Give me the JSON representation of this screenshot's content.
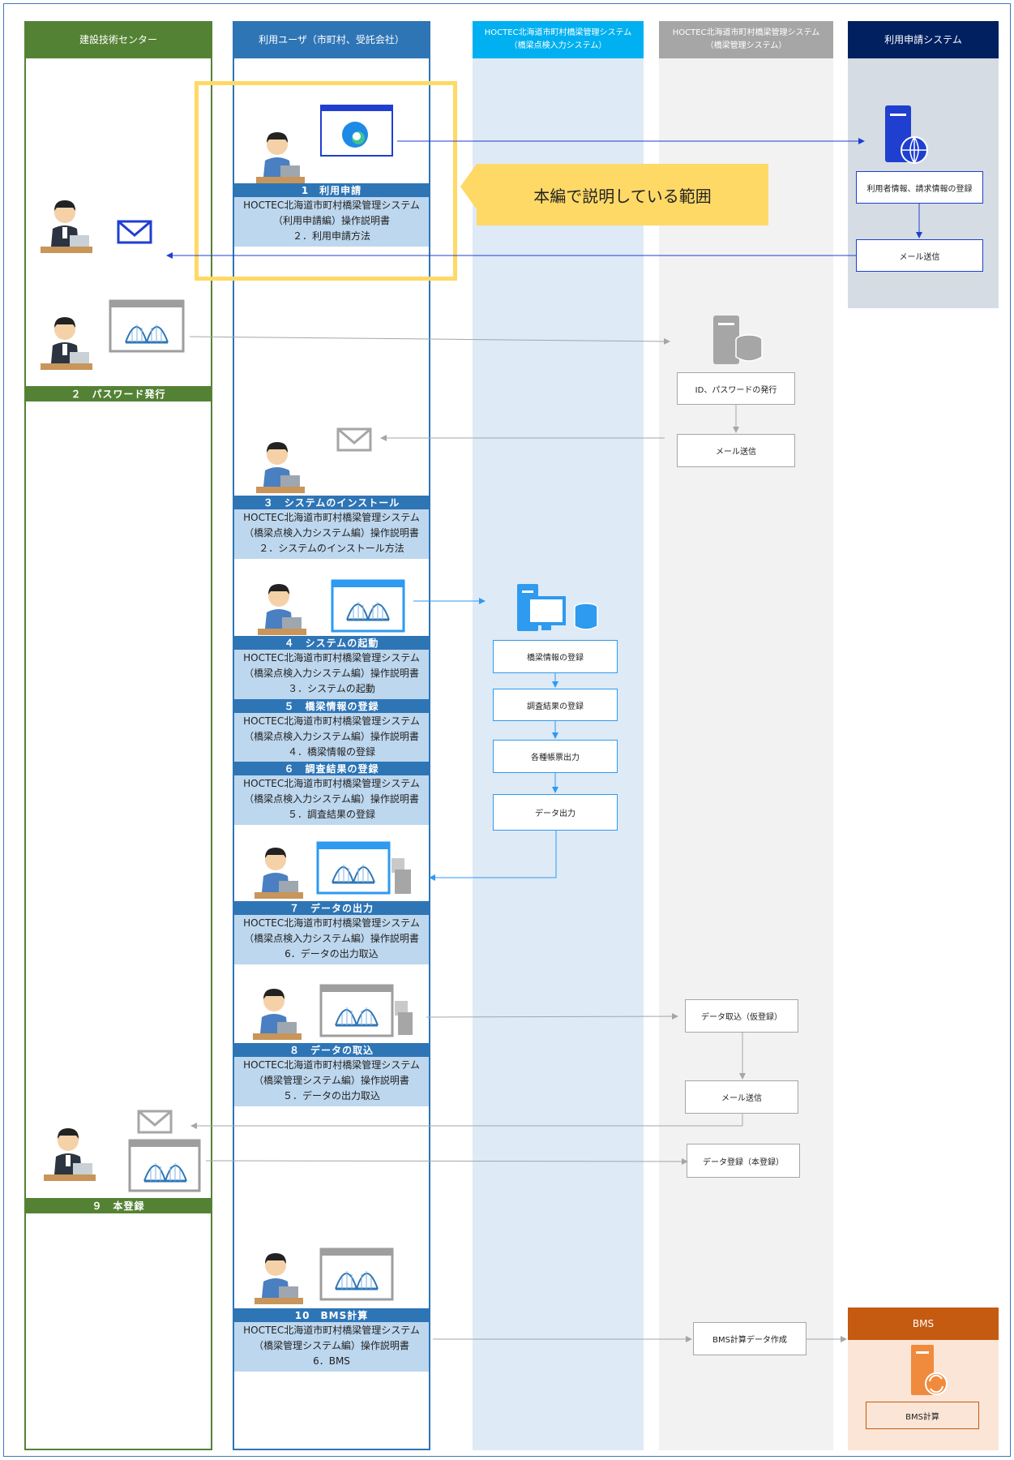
{
  "lanes": {
    "center": "建設技術センター",
    "user": "利用ユーザ（市町村、受託会社）",
    "inspection_line1": "HOCTEC北海道市町村橋梁管理システム",
    "inspection_line2": "（橋梁点検入力システム）",
    "management_line1": "HOCTEC北海道市町村橋梁管理システム",
    "management_line2": "（橋梁管理システム）",
    "application": "利用申請システム",
    "bms": "BMS"
  },
  "callout": "本編で説明している範囲",
  "steps": [
    {
      "title": "1　利用申請",
      "lines": [
        "HOCTEC北海道市町村橋梁管理システム",
        "（利用申請編）操作説明書",
        "２．利用申請方法"
      ]
    },
    {
      "title": "２　パスワード発行"
    },
    {
      "title": "３　システムのインストール",
      "lines": [
        "HOCTEC北海道市町村橋梁管理システム",
        "（橋梁点検入力システム編）操作説明書",
        "２．システムのインストール方法"
      ]
    },
    {
      "title": "４　システムの起動",
      "lines": [
        "HOCTEC北海道市町村橋梁管理システム",
        "（橋梁点検入力システム編）操作説明書",
        "３．システムの起動"
      ]
    },
    {
      "title": "５　橋梁情報の登録",
      "lines": [
        "HOCTEC北海道市町村橋梁管理システム",
        "（橋梁点検入力システム編）操作説明書",
        "４．橋梁情報の登録"
      ]
    },
    {
      "title": "６　調査結果の登録",
      "lines": [
        "HOCTEC北海道市町村橋梁管理システム",
        "（橋梁点検入力システム編）操作説明書",
        "５．調査結果の登録"
      ]
    },
    {
      "title": "７　データの出力",
      "lines": [
        "HOCTEC北海道市町村橋梁管理システム",
        "（橋梁点検入力システム編）操作説明書",
        "6．データの出力取込"
      ]
    },
    {
      "title": "８　データの取込",
      "lines": [
        "HOCTEC北海道市町村橋梁管理システム",
        "（橋梁管理システム編）操作説明書",
        "５．データの出力取込"
      ]
    },
    {
      "title": "９　本登録"
    },
    {
      "title": "10　BMS計算",
      "lines": [
        "HOCTEC北海道市町村橋梁管理システム",
        "（橋梁管理システム編）操作説明書",
        "6．BMS"
      ]
    }
  ],
  "process_boxes": {
    "user_registration": "利用者情報、請求情報の登録",
    "mail_send_app": "メール送信",
    "id_issue": "ID、パスワードの発行",
    "mail_send_mgmt1": "メール送信",
    "bridge_register": "橋梁情報の登録",
    "survey_register": "調査結果の登録",
    "report_output": "各種帳票出力",
    "data_output": "データ出力",
    "data_import": "データ取込（仮登録）",
    "mail_send_mgmt2": "メール送信",
    "data_register": "データ登録（本登録）",
    "bms_data": "BMS計算データ作成",
    "bms_calc": "BMS計算"
  },
  "colors": {
    "center_green": "#548235",
    "user_blue": "#2e75b6",
    "inspection_cyan": "#00b0f0",
    "management_gray": "#a6a6a6",
    "application_navy": "#002060",
    "bms_orange": "#c55a11",
    "callout_yellow": "#ffd966"
  }
}
